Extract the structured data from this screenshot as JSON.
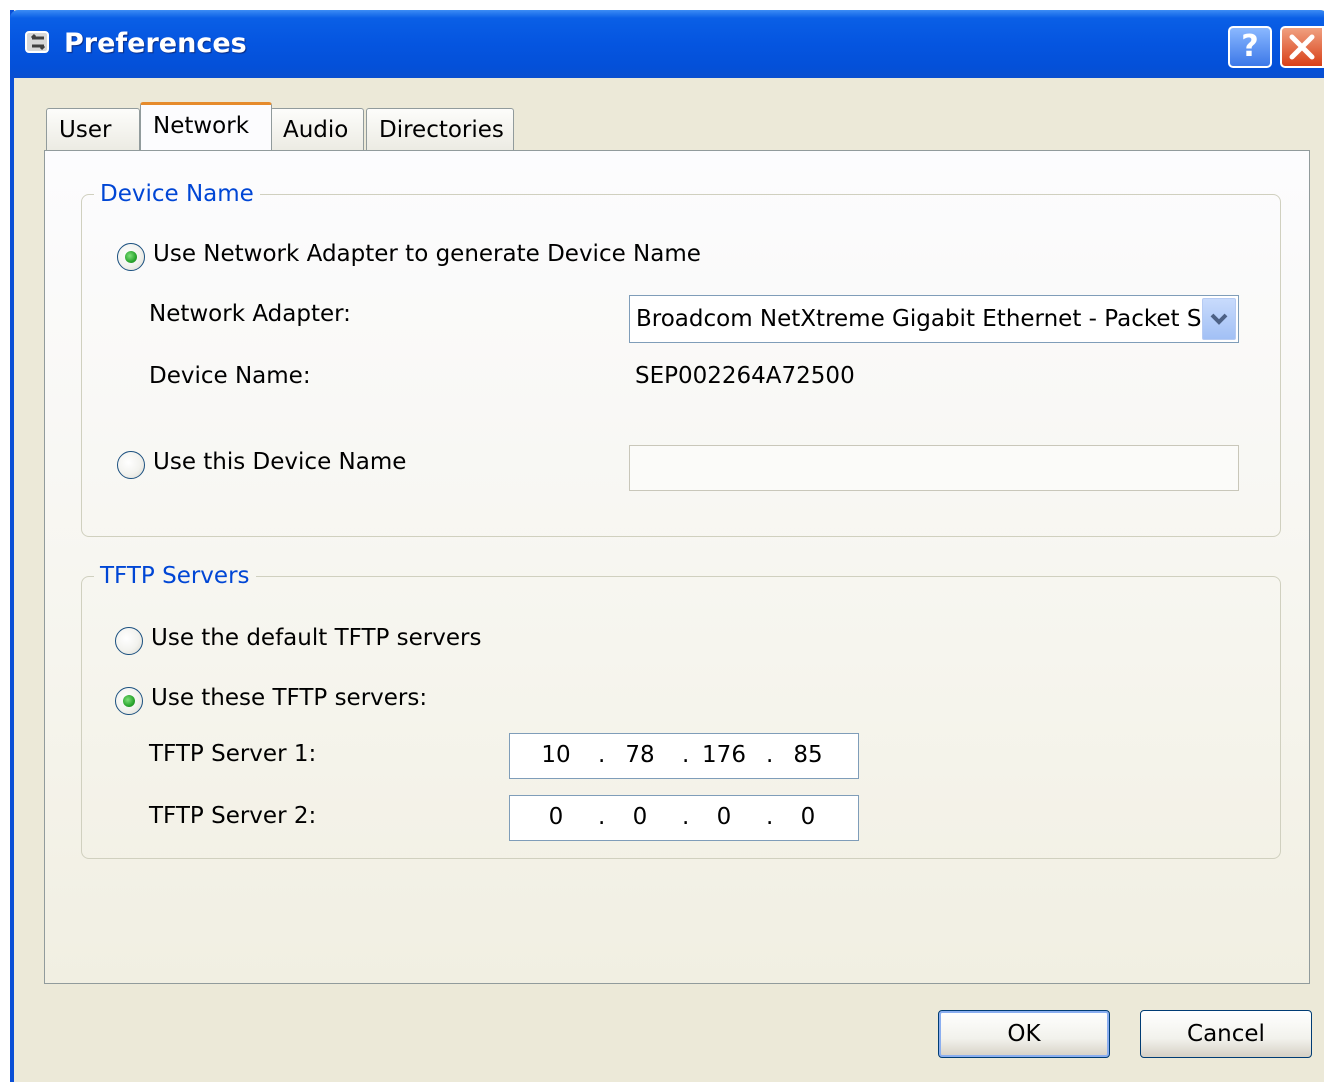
{
  "window": {
    "title": "Preferences",
    "help_label": "?"
  },
  "tabs": [
    {
      "label": "User",
      "active": false
    },
    {
      "label": "Network",
      "active": true
    },
    {
      "label": "Audio",
      "active": false
    },
    {
      "label": "Directories",
      "active": false
    }
  ],
  "device_name_group": {
    "legend": "Device Name",
    "use_adapter_label": "Use Network Adapter to generate Device Name",
    "use_adapter_selected": true,
    "network_adapter_label": "Network Adapter:",
    "network_adapter_value": "Broadcom NetXtreme Gigabit Ethernet - Packet Sc",
    "device_name_label": "Device Name:",
    "device_name_value": "SEP002264A72500",
    "use_this_label": "Use this Device Name",
    "use_this_selected": false,
    "custom_device_name_value": ""
  },
  "tftp_group": {
    "legend": "TFTP Servers",
    "default_label": "Use the default TFTP servers",
    "default_selected": false,
    "these_label": "Use these TFTP servers:",
    "these_selected": true,
    "server1_label": "TFTP Server 1:",
    "server1_octets": [
      "10",
      "78",
      "176",
      "85"
    ],
    "server2_label": "TFTP Server 2:",
    "server2_octets": [
      "0",
      "0",
      "0",
      "0"
    ]
  },
  "buttons": {
    "ok_label": "OK",
    "cancel_label": "Cancel"
  },
  "colors": {
    "title_bar": "#0555e0",
    "group_legend": "#0046d5",
    "active_tab_accent": "#e68b2c",
    "radio_selected": "#2aa52e"
  }
}
